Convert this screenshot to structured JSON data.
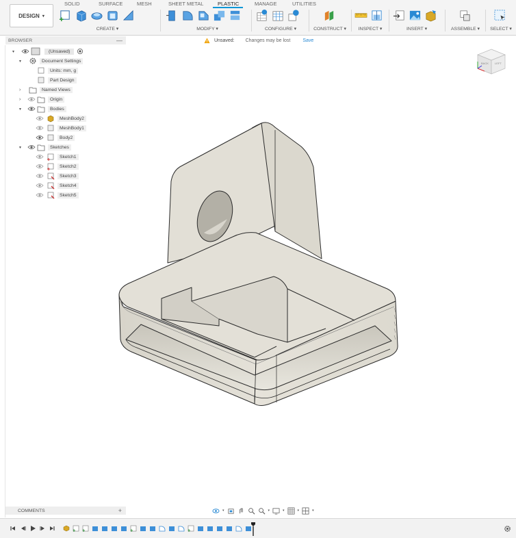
{
  "app": {
    "workspace_button": "DESIGN"
  },
  "toolbar": {
    "tabs": [
      "SOLID",
      "SURFACE",
      "MESH",
      "SHEET METAL",
      "PLASTIC",
      "MANAGE",
      "UTILITIES"
    ],
    "active_tab": "PLASTIC",
    "groups": [
      "CREATE",
      "MODIFY",
      "CONFIGURE",
      "CONSTRUCT",
      "INSPECT",
      "INSERT",
      "ASSEMBLE",
      "SELECT"
    ],
    "accent_color": "#0696d7"
  },
  "status": {
    "label": "Unsaved:",
    "message": "Changes may be lost",
    "save_link": "Save",
    "warning_color": "#f0a30a"
  },
  "browser": {
    "header": "BROWSER",
    "items": [
      {
        "label": "(Unsaved)",
        "icon": "document-icon"
      },
      {
        "label": "Document Settings",
        "icon": "gear-icon"
      },
      {
        "label": "Units: mm, g",
        "icon": "units-icon"
      },
      {
        "label": "Part Design",
        "icon": "part-icon"
      },
      {
        "label": "Named Views",
        "icon": "folder-icon"
      },
      {
        "label": "Origin",
        "icon": "folder-icon"
      },
      {
        "label": "Bodies",
        "icon": "folder-icon"
      },
      {
        "label": "MeshBody2",
        "icon": "mesh-body-icon"
      },
      {
        "label": "MeshBody1",
        "icon": "mesh-body-icon"
      },
      {
        "label": "Body2",
        "icon": "body-icon"
      },
      {
        "label": "Sketches",
        "icon": "folder-icon"
      },
      {
        "label": "Sketch1",
        "icon": "sketch-icon"
      },
      {
        "label": "Sketch2",
        "icon": "sketch-icon"
      },
      {
        "label": "Sketch3",
        "icon": "sketch-icon"
      },
      {
        "label": "Sketch4",
        "icon": "sketch-icon"
      },
      {
        "label": "Sketch5",
        "icon": "sketch-icon"
      }
    ]
  },
  "comments": {
    "header": "COMMENTS"
  },
  "viewcube": {
    "faces": [
      "BACK",
      "LEFT"
    ]
  }
}
